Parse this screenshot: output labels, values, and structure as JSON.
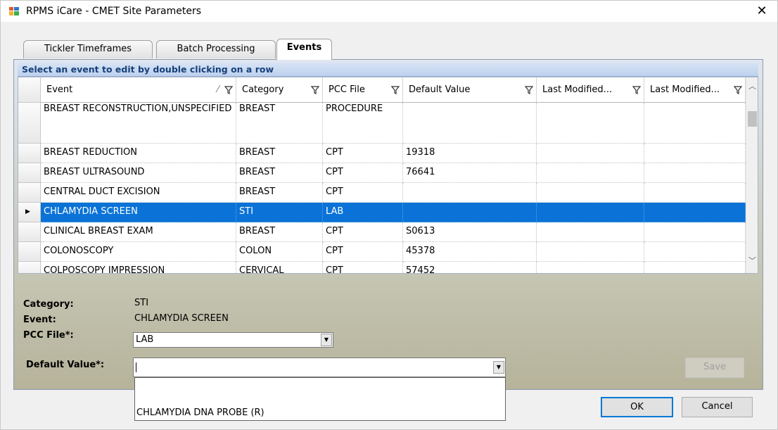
{
  "window": {
    "title": "RPMS iCare - CMET Site Parameters",
    "close_glyph": "✕"
  },
  "tabs": [
    {
      "label": "Tickler Timeframes",
      "active": false
    },
    {
      "label": "Batch Processing",
      "active": false
    },
    {
      "label": "Events",
      "active": true
    }
  ],
  "grid": {
    "caption": "Select an event to edit by double clicking on a row",
    "columns": [
      "Event",
      "Category",
      "PCC File",
      "Default Value",
      "Last Modified...",
      "Last Modified..."
    ],
    "sort_glyph": "⁄",
    "filter_icon": "filter-funnel-icon",
    "rows": [
      {
        "event": "BREAST RECONSTRUCTION,UNSPECIFIED",
        "category": "BREAST",
        "pcc_file": "PROCEDURE",
        "default_value": "",
        "last_modified_1": "",
        "last_modified_2": ""
      },
      {
        "event": "BREAST REDUCTION",
        "category": "BREAST",
        "pcc_file": "CPT",
        "default_value": "19318",
        "last_modified_1": "",
        "last_modified_2": ""
      },
      {
        "event": "BREAST ULTRASOUND",
        "category": "BREAST",
        "pcc_file": "CPT",
        "default_value": "76641",
        "last_modified_1": "",
        "last_modified_2": ""
      },
      {
        "event": "CENTRAL DUCT EXCISION",
        "category": "BREAST",
        "pcc_file": "CPT",
        "default_value": "",
        "last_modified_1": "",
        "last_modified_2": ""
      },
      {
        "event": "CHLAMYDIA SCREEN",
        "category": "STI",
        "pcc_file": "LAB",
        "default_value": "",
        "last_modified_1": "",
        "last_modified_2": "",
        "selected": true
      },
      {
        "event": "CLINICAL BREAST EXAM",
        "category": "BREAST",
        "pcc_file": "CPT",
        "default_value": "S0613",
        "last_modified_1": "",
        "last_modified_2": ""
      },
      {
        "event": "COLONOSCOPY",
        "category": "COLON",
        "pcc_file": "CPT",
        "default_value": "45378",
        "last_modified_1": "",
        "last_modified_2": ""
      },
      {
        "event": "COLPOSCOPY IMPRESSION",
        "category": "CERVICAL",
        "pcc_file": "CPT",
        "default_value": "57452",
        "last_modified_1": "",
        "last_modified_2": ""
      }
    ],
    "current_row_glyph": "▶",
    "scroll_up_glyph": "︿",
    "scroll_down_glyph": "﹀"
  },
  "detail": {
    "category_label": "Category:",
    "category_value": "STI",
    "event_label": "Event:",
    "event_value": "CHLAMYDIA SCREEN",
    "pcc_file_label": "PCC File*:",
    "pcc_file_value": "LAB",
    "default_value_label": "Default Value*:",
    "default_value_value": "",
    "dropdown_glyph": "▼",
    "dropdown_options": [
      "",
      "CHLAMYDIA DNA PROBE (R)"
    ]
  },
  "buttons": {
    "save": "Save",
    "ok": "OK",
    "cancel": "Cancel"
  }
}
